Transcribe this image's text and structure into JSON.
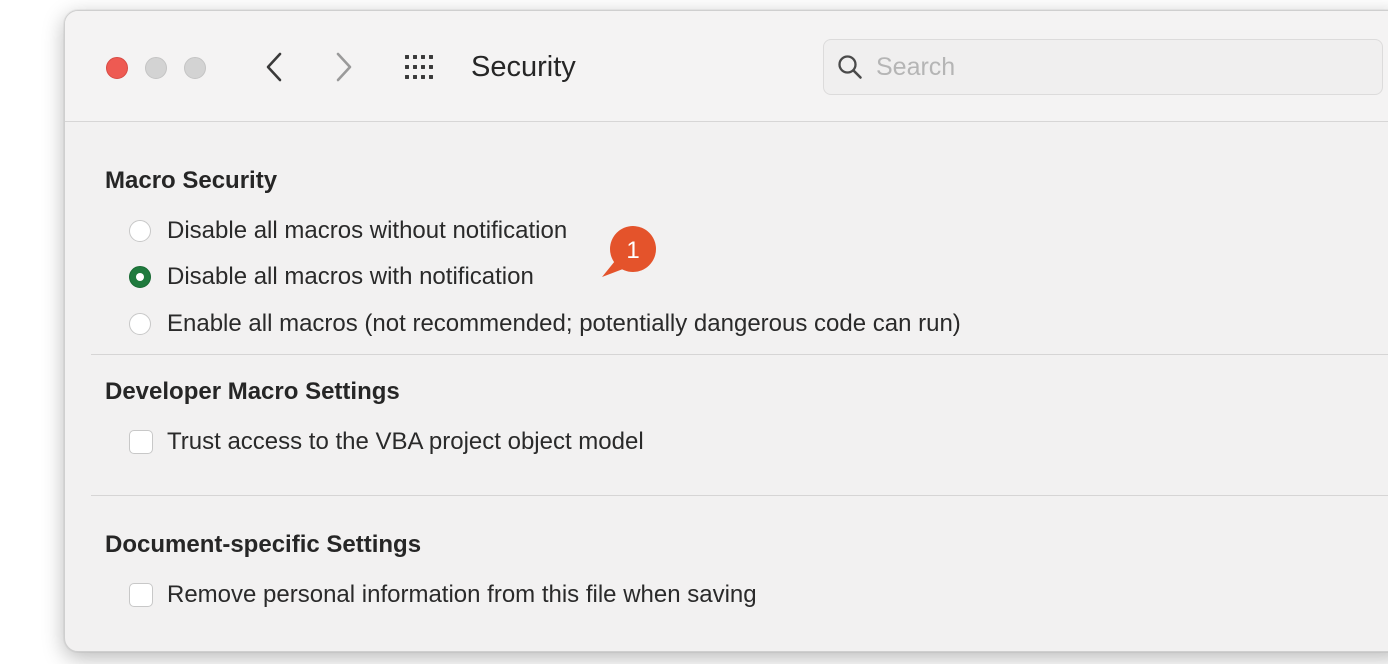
{
  "window": {
    "title": "Security"
  },
  "toolbar": {
    "search_placeholder": "Search",
    "icons": {
      "back": "chevron-left-icon",
      "forward": "chevron-right-icon",
      "grid": "grid-icon",
      "search": "search-icon"
    }
  },
  "colors": {
    "close": "#ee5a52",
    "selected_radio": "#1f7a3d",
    "annotation_badge": "#e4532b"
  },
  "annotation": {
    "number": "1"
  },
  "sections": {
    "macro_security": {
      "title": "Macro Security",
      "options": [
        {
          "label": "Disable all macros without notification",
          "selected": false
        },
        {
          "label": "Disable all macros with notification",
          "selected": true
        },
        {
          "label": "Enable all macros (not recommended; potentially dangerous code can run)",
          "selected": false
        }
      ]
    },
    "developer": {
      "title": "Developer Macro Settings",
      "checkbox_label": "Trust access to the VBA project object model",
      "checked": false
    },
    "document": {
      "title": "Document-specific Settings",
      "checkbox_label": "Remove personal information from this file when saving",
      "checked": false
    }
  }
}
